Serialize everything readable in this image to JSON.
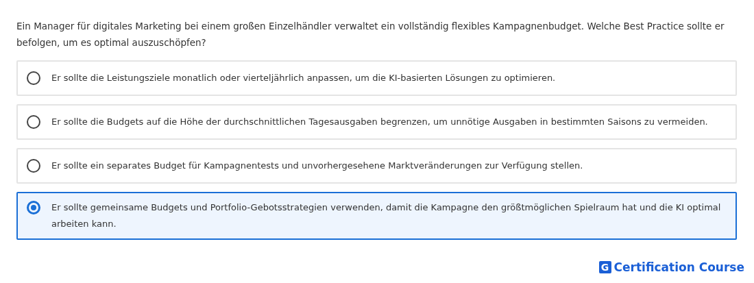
{
  "question": "Ein Manager für digitales Marketing bei einem großen Einzelhändler verwaltet ein vollständig flexibles Kampagnenbudget. Welche Best Practice sollte er befolgen, um es optimal auszuschöpfen?",
  "options": [
    {
      "label": "Er sollte die Leistungsziele monatlich oder vierteljährlich anpassen, um die KI-basierten Lösungen zu optimieren.",
      "selected": false
    },
    {
      "label": "Er sollte die Budgets auf die Höhe der durchschnittlichen Tagesausgaben begrenzen, um unnötige Ausgaben in bestimmten Saisons zu vermeiden.",
      "selected": false
    },
    {
      "label": "Er sollte ein separates Budget für Kampagnentests und unvorhergesehene Marktveränderungen zur Verfügung stellen.",
      "selected": false
    },
    {
      "label": "Er sollte gemeinsame Budgets und Portfolio-Gebotsstrategien verwenden, damit die Kampagne den größtmöglichen Spielraum hat und die KI optimal arbeiten kann.",
      "selected": true
    }
  ],
  "brand": {
    "mark": "G",
    "name": "Certification Course"
  }
}
